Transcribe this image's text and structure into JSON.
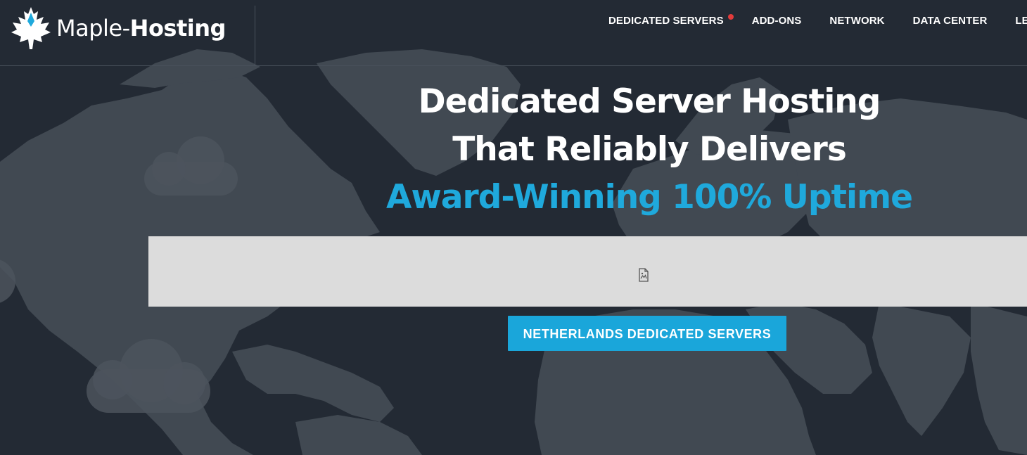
{
  "brand": {
    "name_light": "Maple-",
    "name_bold": "Hosting",
    "accent_color": "#1fa9dc"
  },
  "nav": {
    "items": [
      {
        "label": "DEDICATED SERVERS",
        "badge_dot": true
      },
      {
        "label": "ADD-ONS"
      },
      {
        "label": "NETWORK"
      },
      {
        "label": "DATA CENTER"
      },
      {
        "label": "LEA"
      }
    ],
    "badge_color": "#e23b3b"
  },
  "hero": {
    "line1": "Dedicated Server Hosting",
    "line2": "That Reliably Delivers",
    "line3": "Award-Winning 100% Uptime"
  },
  "image_placeholder": {
    "icon": "broken-image-icon"
  },
  "cta": {
    "label": "NETHERLANDS DEDICATED SERVERS"
  }
}
